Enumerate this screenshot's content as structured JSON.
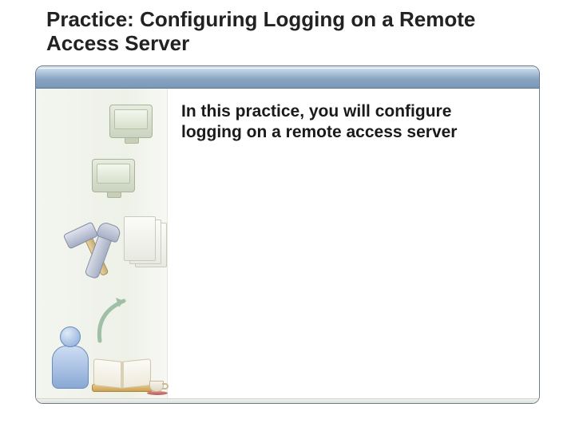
{
  "title": "Practice: Configuring Logging on a Remote Access Server",
  "body_text": "In this practice, you will configure logging on a remote access server",
  "icons": {
    "monitor": "computer-monitor-icon",
    "hammer": "hammer-icon",
    "wrench": "wrench-icon",
    "pages": "document-stack-icon",
    "arrow": "curved-arrow-icon",
    "person": "person-icon",
    "book": "open-book-icon",
    "cup": "coffee-cup-icon"
  },
  "colors": {
    "header_gradient_top": "#d9e6f2",
    "header_gradient_bottom": "#7a98b8",
    "panel_border": "#6a7a8f",
    "sidebar_bg": "#eef1e8"
  }
}
